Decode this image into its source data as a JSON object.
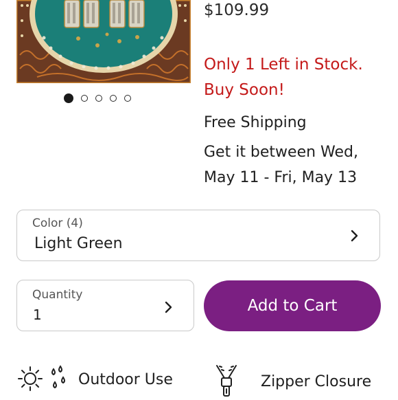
{
  "product": {
    "image_icon": "elephant-tapestry-image",
    "carousel": {
      "count": 5,
      "active_index": 0
    },
    "price": "$109.99",
    "stock_message": "Only 1 Left in Stock. Buy Soon!",
    "shipping": {
      "title": "Free Shipping",
      "delivery": "Get it between Wed, May 11 - Fri, May 13"
    }
  },
  "color": {
    "label": "Color (4)",
    "value": "Light Green"
  },
  "quantity": {
    "label": "Quantity",
    "value": "1"
  },
  "cart": {
    "label": "Add to Cart",
    "color": "#7b1f82"
  },
  "stock_color": "#c41a1a",
  "features": [
    {
      "label": "Outdoor Use",
      "icon": "weather-icon"
    },
    {
      "label": "Zipper Closure",
      "icon": "zipper-icon"
    }
  ]
}
